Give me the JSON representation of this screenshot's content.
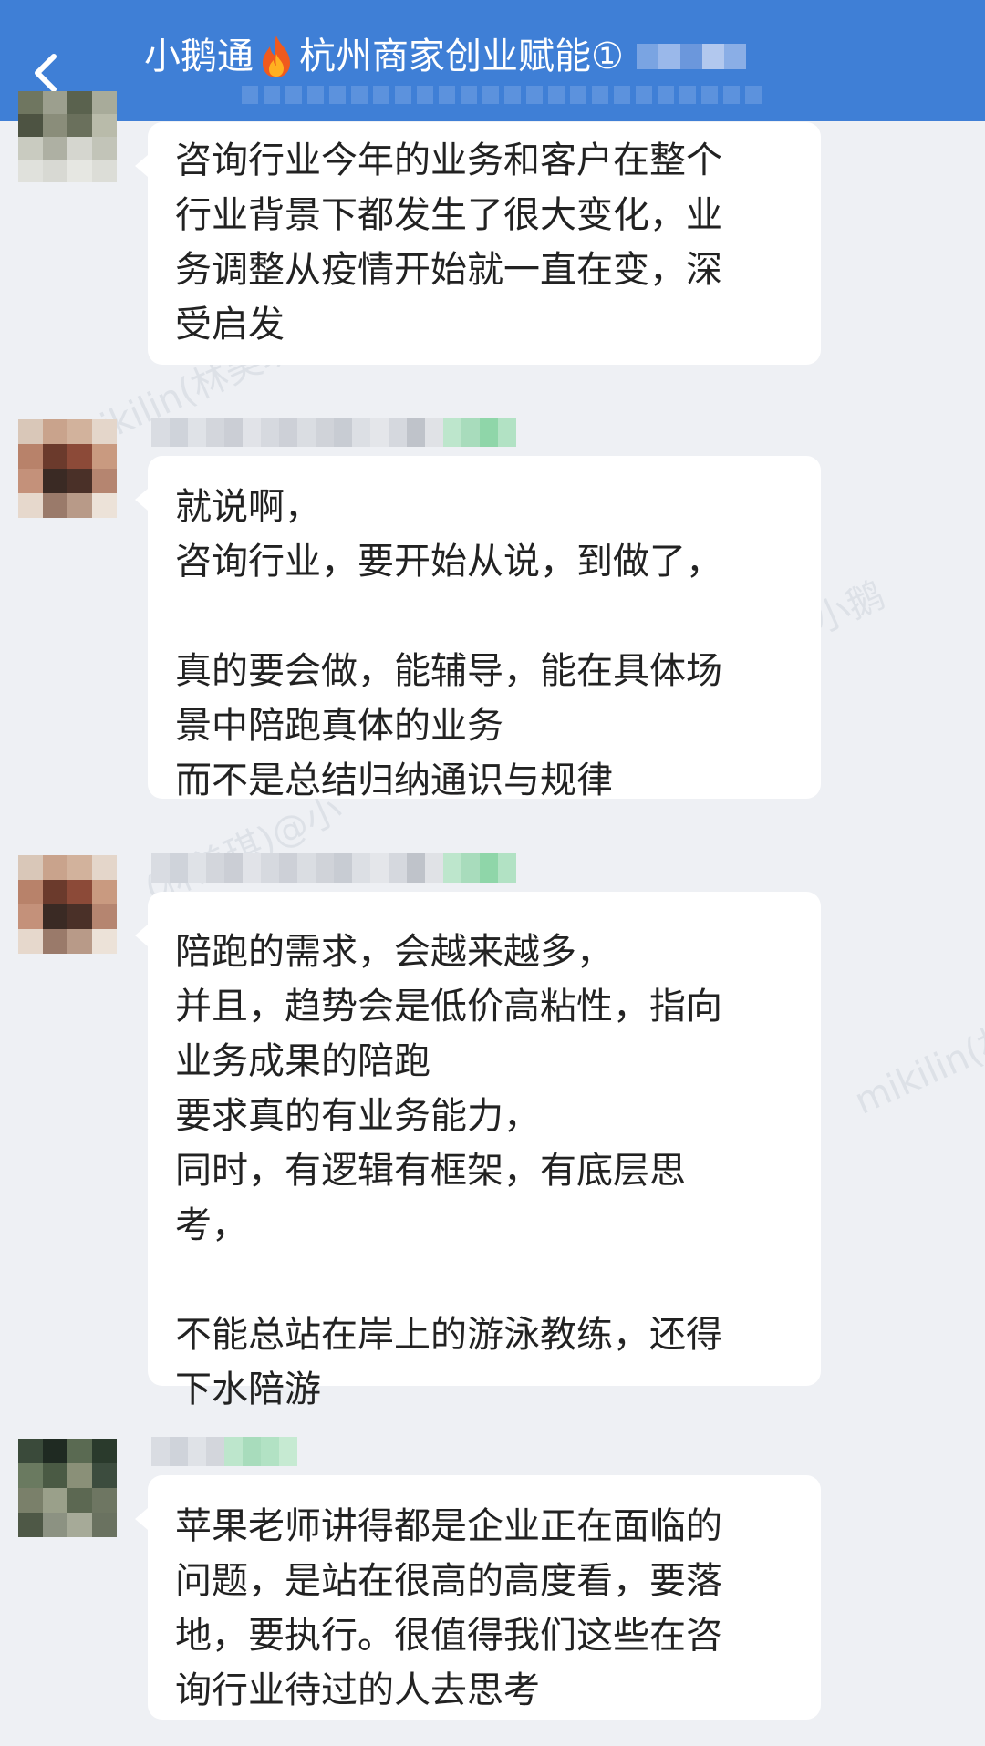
{
  "header": {
    "back_label": "返回",
    "title": "小鹅通",
    "title_suffix": "杭州商家创业赋能①",
    "fire_icon": "fire-icon"
  },
  "watermarks": [
    "mikilin(林美琪)@小",
    "mikilin(林美琪)@小鹅",
    "mikilin(林",
    "(林美琪)@小"
  ],
  "messages": [
    {
      "lines": [
        "咨询行业今年的业务和客户在整个",
        "行业背景下都发生了很大变化，业",
        "务调整从疫情开始就一直在变，深",
        "受启发"
      ]
    },
    {
      "lines": [
        "就说啊，",
        "咨询行业，要开始从说，到做了，",
        "",
        "真的要会做，能辅导，能在具体场",
        "景中陪跑真体的业务",
        "而不是总结归纳通识与规律"
      ]
    },
    {
      "lines": [
        "陪跑的需求，会越来越多，",
        "并且，趋势会是低价高粘性，指向",
        "业务成果的陪跑",
        "要求真的有业务能力，",
        "同时，有逻辑有框架，有底层思",
        "考，",
        "",
        "不能总站在岸上的游泳教练，还得",
        "下水陪游"
      ]
    },
    {
      "lines": [
        "苹果老师讲得都是企业正在面临的",
        "问题，是站在很高的高度看，要落",
        "地，要执行。很值得我们这些在咨",
        "询行业待过的人去思考"
      ]
    }
  ]
}
